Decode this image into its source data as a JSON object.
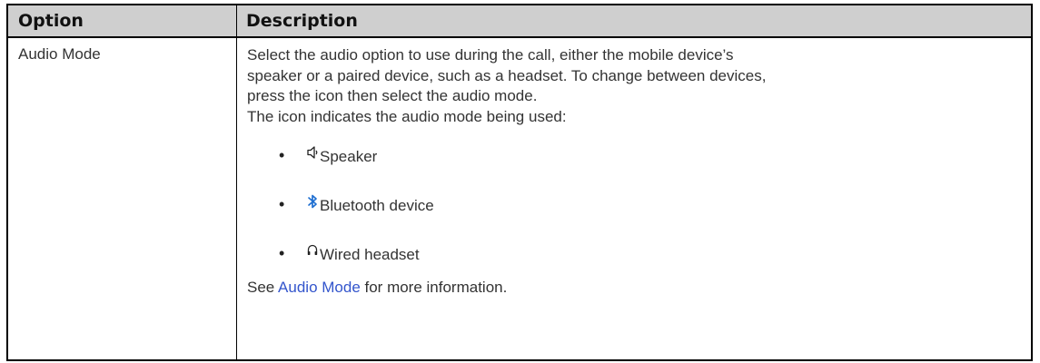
{
  "table": {
    "headers": {
      "option": "Option",
      "description": "Description"
    },
    "row": {
      "option": "Audio Mode",
      "description_lines": [
        "Select the audio option to use during the call, either the mobile device’s",
        "speaker or a paired device, such as a headset. To change between devices,",
        "press the icon then select the audio mode.",
        "The icon indicates the audio mode being used:"
      ],
      "bullets": [
        {
          "icon": "speaker-icon",
          "label": "Speaker"
        },
        {
          "icon": "bluetooth-icon",
          "label": "Bluetooth device"
        },
        {
          "icon": "headset-icon",
          "label": "Wired headset"
        }
      ],
      "footer": {
        "prefix": "See ",
        "link_text": "Audio Mode",
        "suffix": " for more information."
      }
    }
  },
  "colors": {
    "header_bg": "#cfcfcf",
    "link": "#3355cc",
    "bluetooth": "#1f6fd1",
    "text": "#333333"
  }
}
